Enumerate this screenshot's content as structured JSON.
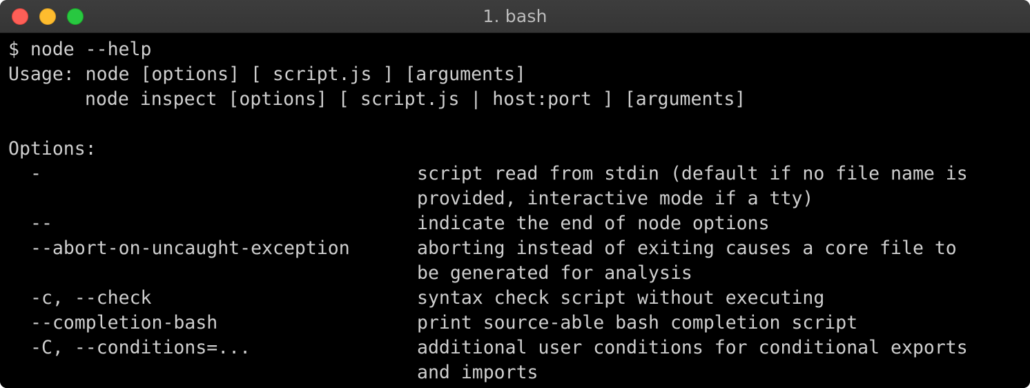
{
  "window": {
    "title": "1. bash"
  },
  "terminal": {
    "prompt_line": "$ node --help",
    "usage_line": "Usage: node [options] [ script.js ] [arguments]",
    "usage_line2": "node inspect [options] [ script.js | host:port ] [arguments]",
    "options_header": "Options:",
    "options": [
      {
        "flag": "-",
        "desc": [
          "script read from stdin (default if no file name is",
          "provided, interactive mode if a tty)"
        ]
      },
      {
        "flag": "--",
        "desc": [
          "indicate the end of node options"
        ]
      },
      {
        "flag": "--abort-on-uncaught-exception",
        "desc": [
          "aborting instead of exiting causes a core file to",
          "be generated for analysis"
        ]
      },
      {
        "flag": "-c, --check",
        "desc": [
          "syntax check script without executing"
        ]
      },
      {
        "flag": "--completion-bash",
        "desc": [
          "print source-able bash completion script"
        ]
      },
      {
        "flag": "-C, --conditions=...",
        "desc": [
          "additional user conditions for conditional exports",
          "and imports"
        ]
      }
    ]
  },
  "colors": {
    "background": "#000000",
    "text": "#cfcfcf",
    "titlebar": "#3a3a3a",
    "close": "#fe5f57",
    "minimize": "#febc2e",
    "maximize": "#28c840"
  }
}
